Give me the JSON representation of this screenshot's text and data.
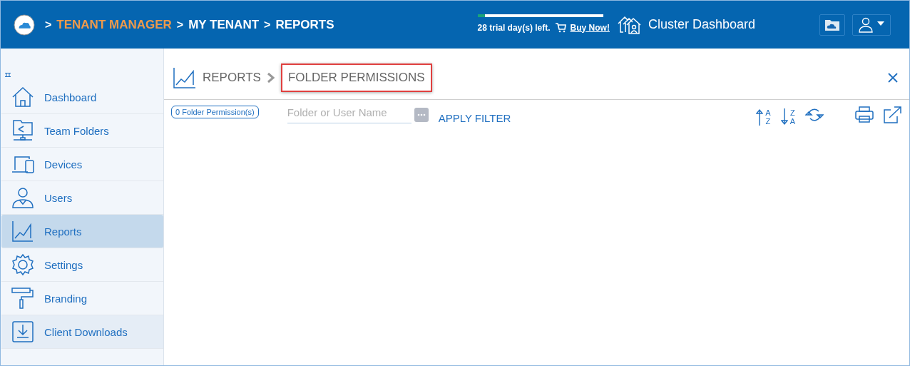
{
  "header": {
    "breadcrumbs": [
      {
        "separator": ">",
        "label": "TENANT MANAGER",
        "kind": "link"
      },
      {
        "separator": ">",
        "label": "MY TENANT",
        "kind": "plain"
      },
      {
        "separator": ">",
        "label": "REPORTS",
        "kind": "plain"
      }
    ],
    "trial": {
      "level": 0.06,
      "text": "28 trial day(s) left.",
      "link": "Buy Now!"
    },
    "cluster_dashboard": "Cluster Dashboard"
  },
  "sidebar": {
    "items": [
      {
        "label": "Dashboard",
        "kind": "home",
        "selected": false,
        "highlighted": false
      },
      {
        "label": "Team Folders",
        "kind": "team",
        "selected": false,
        "highlighted": false
      },
      {
        "label": "Devices",
        "kind": "devices",
        "selected": false,
        "highlighted": false
      },
      {
        "label": "Users",
        "kind": "users",
        "selected": false,
        "highlighted": false
      },
      {
        "label": "Reports",
        "kind": "reports",
        "selected": true,
        "highlighted": false
      },
      {
        "label": "Settings",
        "kind": "settings",
        "selected": false,
        "highlighted": false
      },
      {
        "label": "Branding",
        "kind": "branding",
        "selected": false,
        "highlighted": false
      },
      {
        "label": "Client Downloads",
        "kind": "downloads",
        "selected": false,
        "highlighted": true
      }
    ]
  },
  "panel": {
    "breadcrumb": [
      "REPORTS",
      "FOLDER PERMISSIONS"
    ],
    "count": "0 Folder Permission(s)",
    "filter": {
      "placeholder": "Folder or User Name"
    },
    "apply": "APPLY FILTER",
    "sort_buttons": [
      {
        "kind": "ascending",
        "letters": [
          "A",
          "Z"
        ]
      },
      {
        "kind": "descending",
        "letters": [
          "Z",
          "A"
        ]
      }
    ]
  }
}
